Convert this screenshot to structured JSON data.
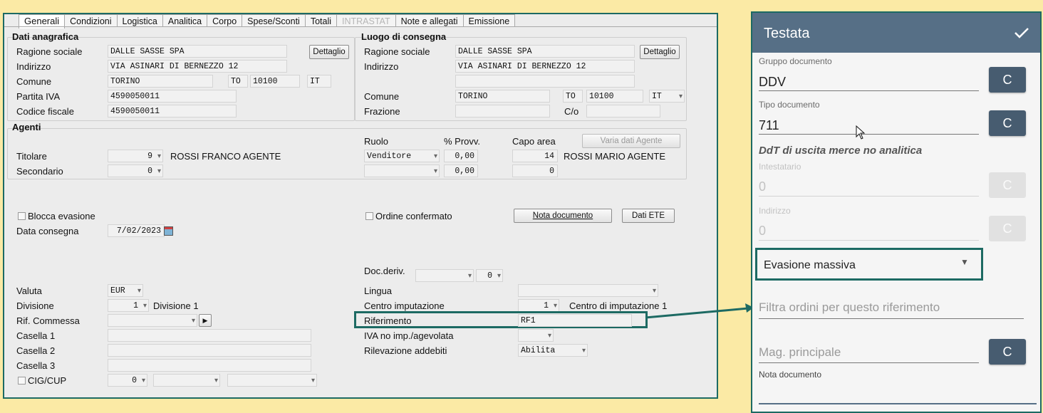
{
  "tabs": [
    "Generali",
    "Condizioni",
    "Logistica",
    "Analitica",
    "Corpo",
    "Spese/Sconti",
    "Totali",
    "INTRASTAT",
    "Note e allegati",
    "Emissione"
  ],
  "anagrafica": {
    "title": "Dati anagrafica",
    "ragione_label": "Ragione sociale",
    "ragione_value": "DALLE SASSE SPA",
    "dettaglio_label": "Dettaglio",
    "indirizzo_label": "Indirizzo",
    "indirizzo_value": "VIA ASINARI DI BERNEZZO 12",
    "comune_label": "Comune",
    "comune_value": "TORINO",
    "prov_value": "TO",
    "cap_value": "10100",
    "nazione_value": "IT",
    "piva_label": "Partita IVA",
    "piva_value": "4590050011",
    "cf_label": "Codice fiscale",
    "cf_value": "4590050011"
  },
  "consegna": {
    "title": "Luogo di consegna",
    "ragione_label": "Ragione sociale",
    "ragione_value": "DALLE SASSE SPA",
    "dettaglio_label": "Dettaglio",
    "indirizzo_label": "Indirizzo",
    "indirizzo_value": "VIA ASINARI DI BERNEZZO 12",
    "comune_label": "Comune",
    "comune_value": "TORINO",
    "prov_value": "TO",
    "cap_value": "10100",
    "nazione_value": "IT",
    "frazione_label": "Frazione",
    "co_label": "C/o"
  },
  "agenti": {
    "title": "Agenti",
    "ruolo_label": "Ruolo",
    "provv_label": "% Provv.",
    "capo_label": "Capo area",
    "varia_label": "Varia dati Agente",
    "titolare_label": "Titolare",
    "titolare_code": "9",
    "titolare_name": "ROSSI FRANCO AGENTE",
    "titolare_ruolo": "Venditore",
    "titolare_provv": "0,00",
    "titolare_capo_code": "14",
    "titolare_capo_name": "ROSSI MARIO AGENTE",
    "secondario_label": "Secondario",
    "secondario_code": "0",
    "secondario_provv": "0,00",
    "secondario_capo_code": "0"
  },
  "misc": {
    "blocca_label": "Blocca evasione",
    "ordine_label": "Ordine confermato",
    "nota_btn": "Nota documento",
    "ete_btn": "Dati ETE",
    "data_consegna_label": "Data consegna",
    "data_consegna_value": "7/02/2023",
    "docderiv_label": "Doc.deriv.",
    "docderiv_value": "0",
    "valuta_label": "Valuta",
    "valuta_value": "EUR",
    "lingua_label": "Lingua",
    "divisione_label": "Divisione",
    "divisione_code": "1",
    "divisione_name": "Divisione 1",
    "centro_label": "Centro imputazione",
    "centro_code": "1",
    "centro_name": "Centro di imputazione 1",
    "commessa_label": "Rif. Commessa",
    "riferimento_label": "Riferimento",
    "riferimento_value": "RF1",
    "casella1_label": "Casella 1",
    "casella2_label": "Casella 2",
    "casella3_label": "Casella 3",
    "iva_label": "IVA no imp./agevolata",
    "rilevazione_label": "Rilevazione addebiti",
    "rilevazione_value": "Abilita",
    "cig_label": "CIG/CUP",
    "cig_value": "0"
  },
  "mobile": {
    "title": "Testata",
    "gruppo_label": "Gruppo documento",
    "gruppo_value": "DDV",
    "tipo_label": "Tipo documento",
    "tipo_value": "711",
    "tipo_desc": "DdT di uscita merce no analitica",
    "intestatario_label": "Intestatario",
    "intestatario_value": "0",
    "indirizzo_label": "Indirizzo",
    "indirizzo_value": "0",
    "evasione_value": "Evasione massiva",
    "filtra_placeholder": "Filtra ordini per questo riferimento",
    "mag_placeholder": "Mag. principale",
    "nota_label": "Nota documento",
    "c_label": "C"
  },
  "colors": {
    "highlight": "#1d6a63",
    "mobile_header": "#566f86",
    "c_button": "#475c70",
    "background": "#fbeaa5"
  }
}
